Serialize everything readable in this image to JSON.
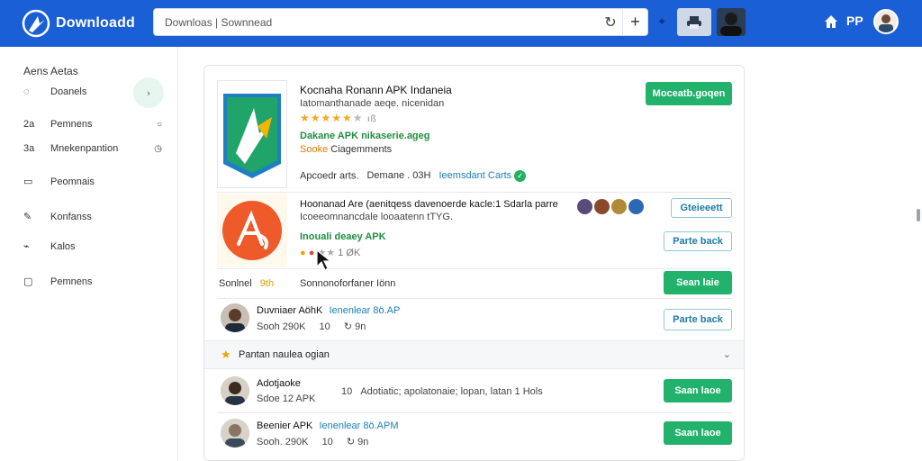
{
  "header": {
    "brand": "Downloadd",
    "search_text": "Downloas | Sownnead",
    "pp_label": "PP"
  },
  "sidebar": {
    "title": "Aens Aetas",
    "items": [
      {
        "label": "Doanels",
        "icon": "shield-icon"
      },
      {
        "label": "Pemnens",
        "prefix": "2a",
        "icon": "info-icon"
      },
      {
        "label": "Mnekenpantion",
        "prefix": "3a",
        "icon": "clock-icon"
      },
      {
        "label": "Peomnais",
        "icon": "folder-icon"
      },
      {
        "label": "Konfanss",
        "icon": "pen-icon"
      },
      {
        "label": "Kalos",
        "icon": "chart-icon"
      },
      {
        "label": "Pemnens",
        "icon": "box-icon"
      }
    ],
    "bubble_text": "›"
  },
  "featured": {
    "title": "Kocnaha Ronann APK Indaneia",
    "subtitle": "Iatomanthanade aeqe. nicenidan",
    "rating_tail": "ıß",
    "green_line": "Dakane APK nikaserie.ageg",
    "orange_tag": "Sooke",
    "tag_rest": "Ciagemments",
    "meta_left": "Apcoedr arts.",
    "meta_mid": "Demane . 03H",
    "meta_link": "Ieemsdant Carts",
    "button": "Moceatb.goqen"
  },
  "second": {
    "title": "Hoonanad Are (aenitqess davenoerde kacle:1 Sdarla parre",
    "subtitle": "Icoeeomnancdale looaatenn tTYG.",
    "green_line": "Inouali deaey APK",
    "rating_tail": "1 ØK",
    "button_top": "Gteieeett",
    "button_bottom": "Parte back"
  },
  "sort_row": {
    "left": "Sonlnel",
    "left_tag": "9th",
    "mid": "Sonnonoforfaner Iönn",
    "button": "Sean laie"
  },
  "list": [
    {
      "title": "Duvniaer AöhK",
      "title_link": "Ienenlear 8ö.AP",
      "sub_left": "Sooh 290K",
      "sub_mid": "10",
      "sub_right": "9n",
      "button": "Parte back",
      "button_style": "outline"
    },
    {
      "title": "Adotjaoke",
      "sub_left": "Sdoe 12 APK",
      "sub_mid": "10",
      "extra": "Adotiatic; apolatonaie; lopan, latan 1 Hols",
      "sub_right": "",
      "button": "Saan laoe",
      "button_style": "green"
    },
    {
      "title": "Beenier APK",
      "title_link": "Ienenlear 8ö.APM",
      "sub_left": "Sooh. 290K",
      "sub_mid": "10",
      "sub_right": "9n",
      "button": "Saan laoe",
      "button_style": "green"
    }
  ],
  "dropdown": {
    "label": "Pantan naulea ogian"
  },
  "colors": {
    "brand_blue": "#1a5fd6",
    "accent_green": "#22b26b"
  }
}
